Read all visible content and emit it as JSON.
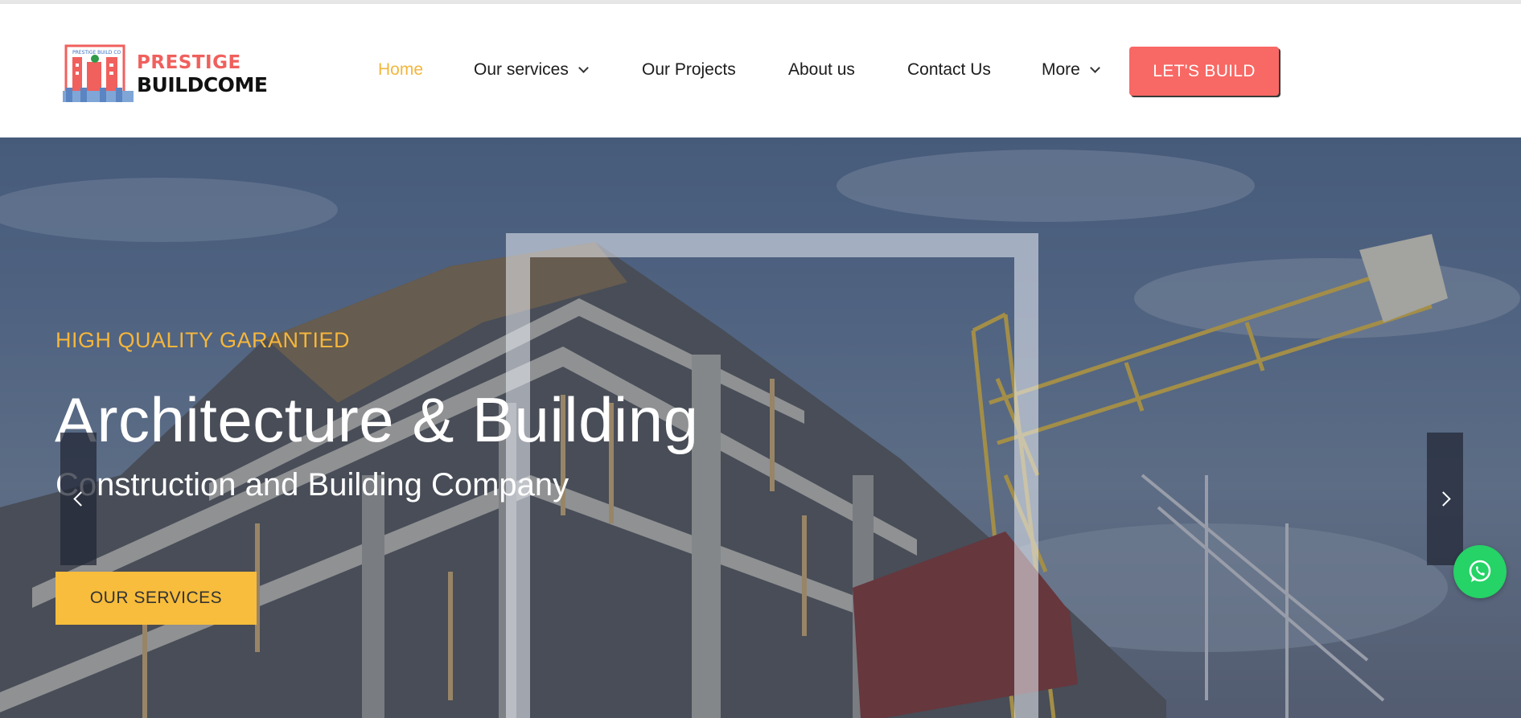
{
  "brand": {
    "name_line1": "PRESTIGE",
    "name_line2": "BUILDCOME",
    "emblem_text": "PRESTIGE BUILD CO",
    "primary_color": "#f86864",
    "accent_color": "#f8bd3c"
  },
  "nav": {
    "items": [
      {
        "label": "Home",
        "active": true,
        "dropdown": false
      },
      {
        "label": "Our services",
        "active": false,
        "dropdown": true
      },
      {
        "label": "Our Projects",
        "active": false,
        "dropdown": false
      },
      {
        "label": "About us",
        "active": false,
        "dropdown": false
      },
      {
        "label": "Contact Us",
        "active": false,
        "dropdown": false
      },
      {
        "label": "More",
        "active": false,
        "dropdown": true
      }
    ],
    "cta_label": "LET'S BUILD"
  },
  "hero": {
    "tagline": "HIGH QUALITY GARANTIED",
    "headline": "Architecture & Building",
    "subline": "Construction and Building Company",
    "button_label": "OUR SERVICES",
    "prev_icon": "chevron-left-icon",
    "next_icon": "chevron-right-icon"
  },
  "widgets": {
    "chat_icon": "whatsapp-icon",
    "chat_color": "#25d366"
  }
}
